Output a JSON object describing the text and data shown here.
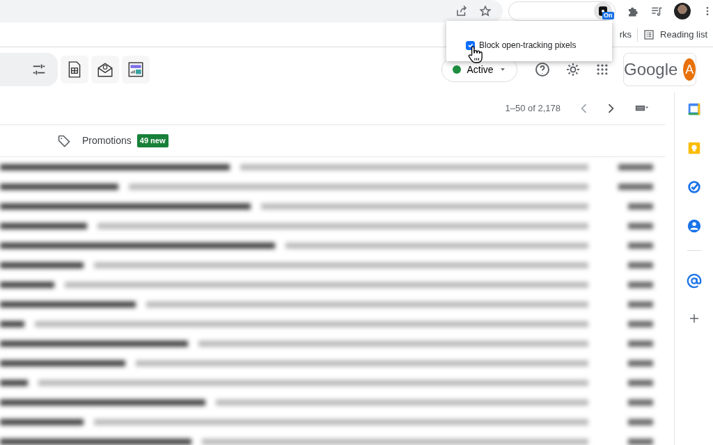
{
  "browser": {
    "extension": {
      "badge": "On"
    },
    "bookmarks": [
      {
        "label": "rks"
      },
      {
        "label": "Reading list"
      }
    ]
  },
  "popup": {
    "options": [
      {
        "label": "Block open-tracking pixels",
        "checked": true
      }
    ]
  },
  "header": {
    "status": "Active",
    "logo": "Google",
    "avatar": "A"
  },
  "toolbar": {
    "range": "1–50 of 2,178"
  },
  "category": {
    "label": "Promotions",
    "badge": "49 new"
  }
}
